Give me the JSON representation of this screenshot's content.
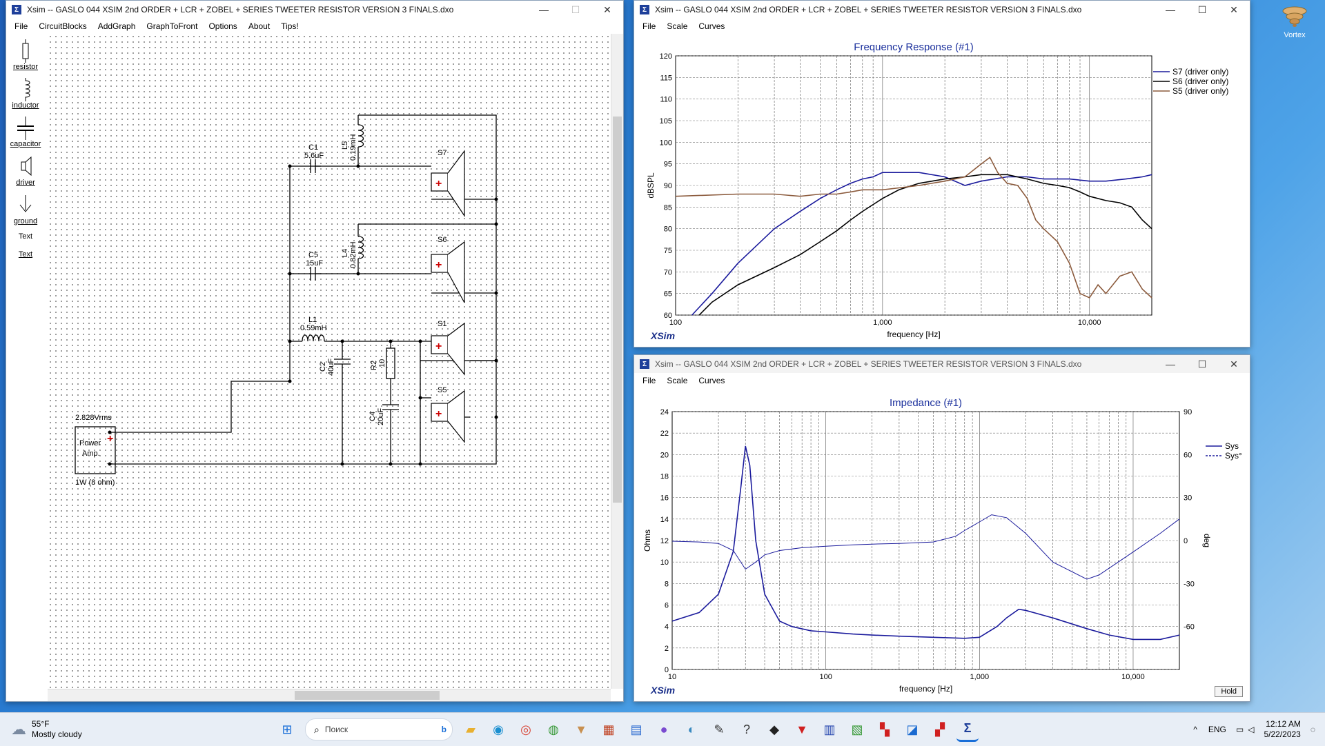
{
  "desktop": {
    "icon_label": "Vortex"
  },
  "schematic_window": {
    "title": "Xsim -- GASLO 044 XSIM     2nd ORDER + LCR + ZOBEL + SERIES TWEETER RESISTOR  VERSION 3 FINALS.dxo",
    "menu": [
      "File",
      "CircuitBlocks",
      "AddGraph",
      "GraphToFront",
      "Options",
      "About",
      "Tips!"
    ],
    "tools": [
      "resistor",
      "inductor",
      "capacitor",
      "driver",
      "ground",
      "Text",
      "Text"
    ],
    "parts": {
      "c1_name": "C1",
      "c1_val": "5.6uF",
      "l5_name": "L5",
      "l5_val": "0.19mH",
      "s7": "S7",
      "c5_name": "C5",
      "c5_val": "15uF",
      "l4_name": "L4",
      "l4_val": "0.82mH",
      "s6": "S6",
      "l1_name": "L1",
      "l1_val": "0.59mH",
      "s1": "S1",
      "c2_name": "C2",
      "c2_val": "40uF",
      "r2_name": "R2",
      "r2_val": "10",
      "c4_name": "C4",
      "c4_val": "20uF",
      "s5": "S5",
      "amp_level": "2.828Vrms",
      "amp_line1": "Power",
      "amp_line2": "Amp.",
      "amp_rating": "1W (8 ohm)"
    }
  },
  "freq_window": {
    "title": "Xsim -- GASLO 044 XSIM     2nd ORDER + LCR + ZOBEL + SERIES TWEETER RESISTOR  VERSION 3 FINALS.dxo",
    "menu": [
      "File",
      "Scale",
      "Curves"
    ],
    "brand": "XSim"
  },
  "imp_window": {
    "title": "Xsim -- GASLO 044 XSIM     2nd ORDER + LCR + ZOBEL + SERIES TWEETER RESISTOR  VERSION 3 FINALS.dxo",
    "menu": [
      "File",
      "Scale",
      "Curves"
    ],
    "brand": "XSim",
    "hold_label": "Hold"
  },
  "chart_data": [
    {
      "type": "line",
      "title": "Frequency Response (#1)",
      "xlabel": "frequency [Hz]",
      "ylabel": "dBSPL",
      "x_scale": "log",
      "xlim": [
        100,
        20000
      ],
      "ylim": [
        60,
        120
      ],
      "x_ticks": [
        "100",
        "1,000",
        "10,000"
      ],
      "y_ticks": [
        60,
        65,
        70,
        75,
        80,
        85,
        90,
        95,
        100,
        105,
        110,
        115,
        120
      ],
      "grid": true,
      "legend_position": "right",
      "series": [
        {
          "name": "S7 (driver only)",
          "color": "#1a1a9c",
          "x": [
            120,
            150,
            200,
            300,
            400,
            500,
            600,
            700,
            800,
            900,
            1000,
            1200,
            1500,
            2000,
            2500,
            3000,
            4000,
            5000,
            6000,
            8000,
            10000,
            12000,
            15000,
            18000,
            20000
          ],
          "y": [
            60,
            65,
            72,
            80,
            84,
            87,
            89,
            90.5,
            91.5,
            92,
            93,
            93,
            93,
            92,
            90,
            91,
            92,
            92,
            91.5,
            91.5,
            91,
            91,
            91.5,
            92,
            92.5
          ]
        },
        {
          "name": "S6 (driver only)",
          "color": "#000000",
          "x": [
            130,
            150,
            200,
            300,
            400,
            500,
            600,
            700,
            800,
            1000,
            1200,
            1500,
            2000,
            2500,
            3000,
            4000,
            5000,
            6000,
            7000,
            8000,
            9000,
            10000,
            12000,
            14000,
            16000,
            18000,
            20000
          ],
          "y": [
            60,
            63,
            67,
            71,
            74,
            77,
            79.5,
            82,
            84,
            87,
            89,
            90.5,
            91.5,
            92,
            92.5,
            92.5,
            91.5,
            90.5,
            90,
            89.5,
            88.5,
            87.5,
            86.5,
            86,
            85,
            82,
            80
          ]
        },
        {
          "name": "S5 (driver only)",
          "color": "#8b5a3c",
          "x": [
            100,
            200,
            300,
            400,
            500,
            600,
            700,
            800,
            1000,
            1500,
            2000,
            2500,
            3000,
            3300,
            3600,
            4000,
            4500,
            5000,
            5500,
            6000,
            7000,
            8000,
            9000,
            10000,
            11000,
            12000,
            14000,
            16000,
            18000,
            20000
          ],
          "y": [
            87.5,
            88,
            88,
            87.5,
            88,
            88,
            88.5,
            89,
            89,
            90,
            91,
            92,
            95,
            96.5,
            93,
            90.5,
            90,
            87,
            82,
            80,
            77,
            72,
            65,
            64,
            67,
            65,
            69,
            70,
            66,
            64
          ]
        }
      ]
    },
    {
      "type": "line",
      "title": "Impedance (#1)",
      "xlabel": "frequency [Hz]",
      "ylabel": "Ohms",
      "y2label": "deg",
      "x_scale": "log",
      "xlim": [
        10,
        20000
      ],
      "ylim": [
        0,
        24
      ],
      "y2lim": [
        -90,
        90
      ],
      "x_ticks": [
        "10",
        "100",
        "1,000",
        "10,000"
      ],
      "y_ticks": [
        0,
        2,
        4,
        6,
        8,
        10,
        12,
        14,
        16,
        18,
        20,
        22,
        24
      ],
      "y2_ticks": [
        -60,
        -30,
        0,
        30,
        60,
        90
      ],
      "grid": true,
      "legend_position": "right",
      "series": [
        {
          "name": "Sys",
          "color": "#1a1a9c",
          "axis": "left",
          "x": [
            10,
            15,
            20,
            25,
            28,
            30,
            32,
            35,
            40,
            50,
            60,
            80,
            100,
            150,
            200,
            300,
            500,
            800,
            1000,
            1300,
            1500,
            1800,
            2000,
            3000,
            5000,
            7000,
            10000,
            15000,
            20000
          ],
          "y": [
            4.5,
            5.3,
            7,
            11,
            17,
            20.8,
            19,
            12,
            7,
            4.5,
            4,
            3.6,
            3.5,
            3.3,
            3.2,
            3.1,
            3,
            2.9,
            3,
            4,
            4.8,
            5.6,
            5.5,
            4.8,
            3.8,
            3.2,
            2.8,
            2.8,
            3.2
          ]
        },
        {
          "name": "Sys°",
          "color": "#1a1a9c",
          "axis": "right",
          "x": [
            10,
            15,
            20,
            25,
            30,
            35,
            40,
            50,
            70,
            100,
            150,
            200,
            300,
            500,
            700,
            800,
            1000,
            1200,
            1500,
            2000,
            3000,
            5000,
            6000,
            8000,
            10000,
            15000,
            20000
          ],
          "y": [
            -0.5,
            -1,
            -2,
            -7,
            -20,
            -15,
            -10,
            -7,
            -5,
            -4,
            -3,
            -2.5,
            -2,
            -1,
            3,
            7,
            13,
            18,
            16,
            5,
            -15,
            -27,
            -24,
            -15,
            -8,
            5,
            15
          ]
        }
      ]
    }
  ],
  "taskbar": {
    "weather_temp": "55°F",
    "weather_desc": "Mostly cloudy",
    "search_placeholder": "Поиск",
    "lang": "ENG",
    "time": "12:12 AM",
    "date": "5/22/2023"
  }
}
